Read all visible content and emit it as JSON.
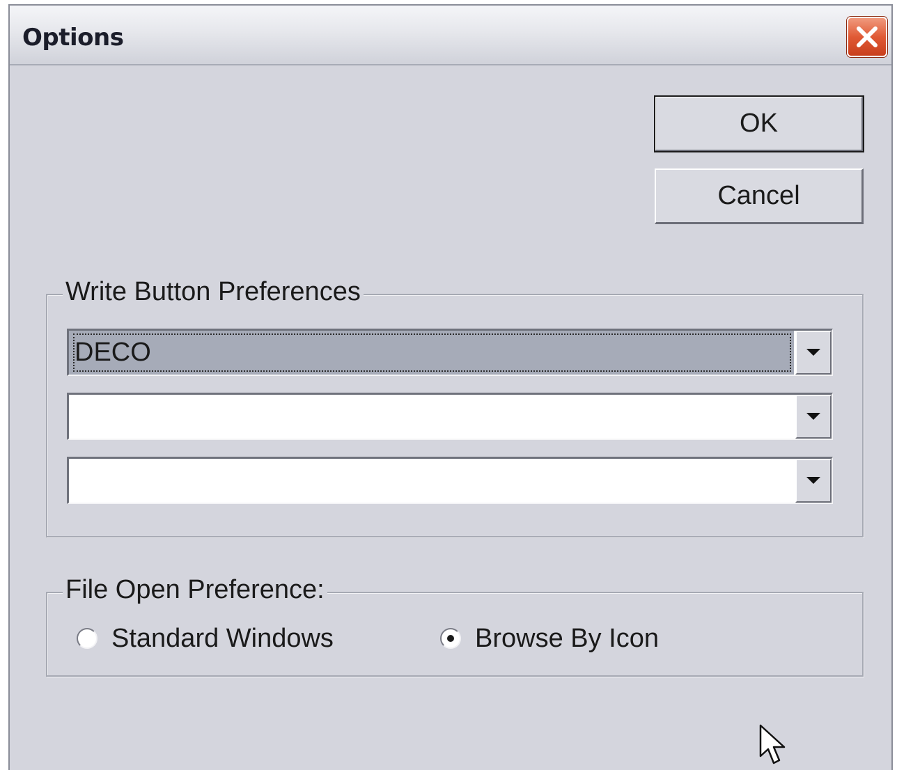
{
  "window": {
    "title": "Options"
  },
  "buttons": {
    "ok_label": "OK",
    "cancel_label": "Cancel"
  },
  "write_button_preferences": {
    "legend": "Write Button Preferences",
    "combos": [
      {
        "value": "DECO",
        "selected": true
      },
      {
        "value": "",
        "selected": false
      },
      {
        "value": "",
        "selected": false
      }
    ]
  },
  "file_open_preference": {
    "legend": "File Open Preference:",
    "options": [
      {
        "label": "Standard Windows",
        "checked": false
      },
      {
        "label": "Browse By Icon",
        "checked": true
      }
    ]
  },
  "colors": {
    "dialog_background": "#d4d5dd",
    "close_button": "#e05a35",
    "selected_combo_background": "#a6abb8"
  },
  "icons": {
    "close": "close-x-icon",
    "dropdown": "triangle-down-icon",
    "cursor": "arrow-cursor-icon"
  }
}
